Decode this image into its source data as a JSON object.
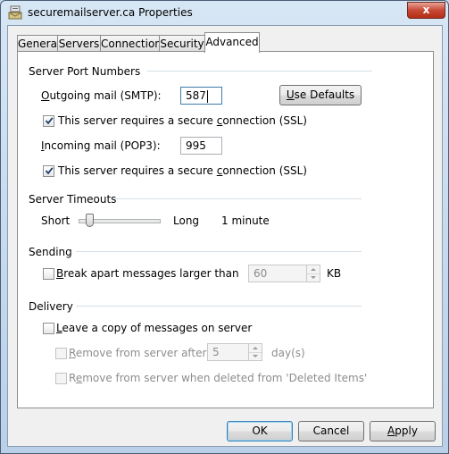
{
  "window": {
    "title": "securemailserver.ca Properties",
    "close_glyph": "x"
  },
  "tabs": [
    {
      "label": "General",
      "active": false
    },
    {
      "label": "Servers",
      "active": false
    },
    {
      "label": "Connection",
      "active": false
    },
    {
      "label": "Security",
      "active": false
    },
    {
      "label": "Advanced",
      "active": true
    }
  ],
  "ports": {
    "group_title": "Server Port Numbers",
    "smtp": {
      "label_pre": "",
      "label_key": "O",
      "label_post": "utgoing mail (SMTP):",
      "value": "587"
    },
    "use_defaults": {
      "pre": "",
      "key": "U",
      "post": "se Defaults"
    },
    "smtp_ssl": {
      "checked": true,
      "pre": "This server requires a secure ",
      "key": "c",
      "post": "onnection (SSL)"
    },
    "pop3": {
      "label_pre": "",
      "label_key": "I",
      "label_post": "ncoming mail (POP3):",
      "value": "995"
    },
    "pop3_ssl": {
      "checked": true,
      "pre": "This server requires a secure ",
      "key": "c",
      "post": "onnection (SSL)"
    }
  },
  "timeouts": {
    "group_title": "Server Timeouts",
    "short_label": "Short",
    "long_label": "Long",
    "value_label": "1 minute",
    "slider_fraction": 0.1
  },
  "sending": {
    "group_title": "Sending",
    "break_apart": {
      "checked": false,
      "pre": "",
      "key": "B",
      "post": "reak apart messages larger than"
    },
    "size_value": "60",
    "size_unit": "KB"
  },
  "delivery": {
    "group_title": "Delivery",
    "leave_copy": {
      "checked": false,
      "pre": "",
      "key": "L",
      "post": "eave a copy of messages on server"
    },
    "remove_after": {
      "checked": false,
      "pre": "",
      "key": "R",
      "post": "emove from server after"
    },
    "days_value": "5",
    "days_unit": "day(s)",
    "remove_deleted": {
      "checked": false,
      "pre": "R",
      "key": "e",
      "post": "move from server when deleted from 'Deleted Items'"
    }
  },
  "buttons": {
    "ok": "OK",
    "cancel": "Cancel",
    "apply": {
      "pre": "",
      "key": "A",
      "post": "pply"
    }
  },
  "icons": {
    "title": "mail-server-icon",
    "check": "checkmark-icon",
    "spin_up": "spin-up-arrow-icon",
    "spin_down": "spin-down-arrow-icon"
  }
}
